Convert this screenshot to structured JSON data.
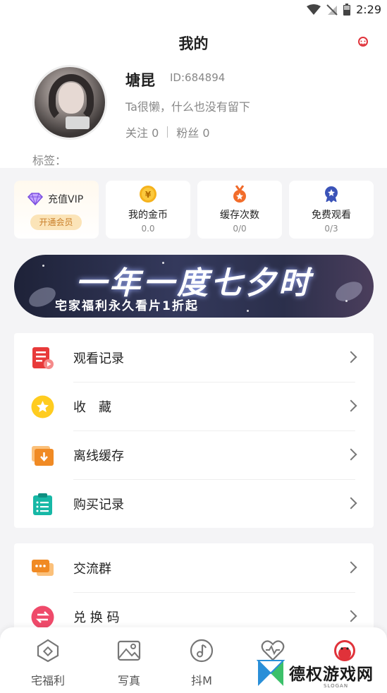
{
  "status_bar": {
    "time": "2:29"
  },
  "header": {
    "title": "我的",
    "username": "塘昆",
    "user_id": "ID:684894",
    "bio": "Ta很懒，什么也没有留下",
    "following": "关注 0",
    "followers": "粉丝 0",
    "tags_label": "标签："
  },
  "cards": {
    "vip_label": "充值VIP",
    "vip_button": "开通会员",
    "coins_label": "我的金币",
    "coins_value": "0.0",
    "cache_label": "缓存次数",
    "cache_value": "0/0",
    "free_label": "免费观看",
    "free_value": "0/3"
  },
  "banner": {
    "title": "一年一度七夕时",
    "subtitle": "宅家福利永久看片1折起"
  },
  "menu_group_1": [
    {
      "label": "观看记录",
      "icon": "history-icon"
    },
    {
      "label": "收　藏",
      "icon": "star-icon"
    },
    {
      "label": "离线缓存",
      "icon": "download-icon"
    },
    {
      "label": "购买记录",
      "icon": "clipboard-icon"
    }
  ],
  "menu_group_2": [
    {
      "label": "交流群",
      "icon": "chat-icon"
    },
    {
      "label": "兑 换 码",
      "icon": "exchange-icon"
    }
  ],
  "bottom_nav": [
    {
      "label": "宅福利",
      "icon": "home-icon"
    },
    {
      "label": "写真",
      "icon": "image-icon"
    },
    {
      "label": "抖M",
      "icon": "music-icon"
    },
    {
      "label": "",
      "icon": "heart-pulse-icon"
    },
    {
      "label": "",
      "icon": "profile-icon"
    }
  ],
  "watermark": {
    "text": "德权游戏网",
    "slogan": "SLOGAN"
  },
  "colors": {
    "accent": "#e0323a",
    "vip_gold": "#c97f2a",
    "orange": "#f08a24"
  }
}
